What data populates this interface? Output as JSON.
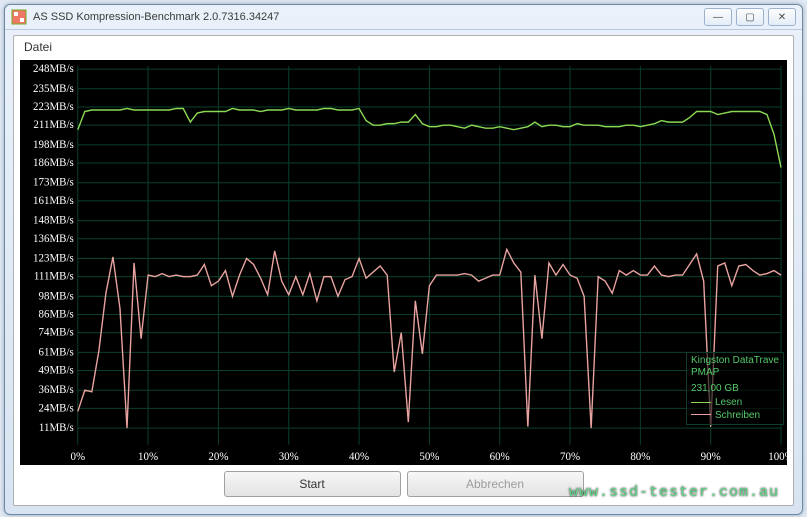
{
  "window": {
    "title": "AS SSD Kompression-Benchmark 2.0.7316.34247",
    "menu_file": "Datei",
    "btn_minimize": "—",
    "btn_maximize": "▢",
    "btn_close": "✕"
  },
  "buttons": {
    "start": "Start",
    "cancel": "Abbrechen"
  },
  "legend": {
    "device_line1": "Kingston DataTrave",
    "device_line2": "PMAP",
    "capacity": "231,00 GB",
    "read": "Lesen",
    "write": "Schreiben",
    "read_color": "#8cd953",
    "write_color": "#e9a3a0"
  },
  "watermark": "www.ssd-tester.com.au",
  "chart_data": {
    "type": "line",
    "title": "",
    "xlabel": "",
    "ylabel": "",
    "x_tick_labels": [
      "0%",
      "10%",
      "20%",
      "30%",
      "40%",
      "50%",
      "60%",
      "70%",
      "80%",
      "90%",
      "100%"
    ],
    "y_tick_labels": [
      "11MB/s",
      "24MB/s",
      "36MB/s",
      "49MB/s",
      "61MB/s",
      "74MB/s",
      "86MB/s",
      "98MB/s",
      "111MB/s",
      "123MB/s",
      "136MB/s",
      "148MB/s",
      "161MB/s",
      "173MB/s",
      "186MB/s",
      "198MB/s",
      "211MB/s",
      "223MB/s",
      "235MB/s",
      "248MB/s"
    ],
    "ylim": [
      0,
      250
    ],
    "xlim": [
      0,
      100
    ],
    "x": [
      0,
      1,
      2,
      3,
      4,
      5,
      6,
      7,
      8,
      9,
      10,
      11,
      12,
      13,
      14,
      15,
      16,
      17,
      18,
      19,
      20,
      21,
      22,
      23,
      24,
      25,
      26,
      27,
      28,
      29,
      30,
      31,
      32,
      33,
      34,
      35,
      36,
      37,
      38,
      39,
      40,
      41,
      42,
      43,
      44,
      45,
      46,
      47,
      48,
      49,
      50,
      51,
      52,
      53,
      54,
      55,
      56,
      57,
      58,
      59,
      60,
      61,
      62,
      63,
      64,
      65,
      66,
      67,
      68,
      69,
      70,
      71,
      72,
      73,
      74,
      75,
      76,
      77,
      78,
      79,
      80,
      81,
      82,
      83,
      84,
      85,
      86,
      87,
      88,
      89,
      90,
      91,
      92,
      93,
      94,
      95,
      96,
      97,
      98,
      99,
      100
    ],
    "series": [
      {
        "name": "Lesen",
        "color": "#8cd953",
        "values": [
          208,
          220,
          221,
          221,
          221,
          221,
          221,
          222,
          221,
          221,
          221,
          221,
          221,
          221,
          222,
          222,
          213,
          219,
          220,
          220,
          220,
          220,
          222,
          221,
          221,
          221,
          220,
          221,
          221,
          221,
          222,
          221,
          221,
          221,
          221,
          222,
          222,
          221,
          221,
          221,
          222,
          214,
          211,
          211,
          212,
          212,
          213,
          213,
          218,
          212,
          210,
          210,
          211,
          211,
          210,
          209,
          211,
          210,
          209,
          209,
          210,
          209,
          208,
          209,
          210,
          213,
          210,
          211,
          211,
          210,
          210,
          212,
          211,
          211,
          211,
          210,
          210,
          210,
          211,
          211,
          210,
          211,
          212,
          214,
          213,
          213,
          213,
          216,
          220,
          220,
          220,
          218,
          219,
          220,
          220,
          220,
          220,
          220,
          218,
          205,
          183
        ]
      },
      {
        "name": "Schreiben",
        "color": "#e9a3a0",
        "values": [
          22,
          36,
          35,
          62,
          100,
          124,
          90,
          11,
          120,
          70,
          112,
          111,
          113,
          111,
          112,
          111,
          111,
          112,
          119,
          105,
          108,
          115,
          98,
          112,
          123,
          119,
          110,
          99,
          128,
          108,
          99,
          111,
          99,
          113,
          95,
          111,
          111,
          98,
          109,
          111,
          123,
          110,
          114,
          118,
          112,
          48,
          74,
          15,
          95,
          60,
          105,
          112,
          112,
          112,
          112,
          113,
          112,
          108,
          110,
          112,
          112,
          129,
          120,
          114,
          12,
          112,
          70,
          120,
          112,
          119,
          112,
          110,
          98,
          11,
          111,
          108,
          100,
          115,
          112,
          115,
          112,
          112,
          118,
          112,
          111,
          112,
          112,
          119,
          126,
          108,
          12,
          118,
          120,
          105,
          118,
          119,
          115,
          112,
          113,
          115,
          112
        ]
      }
    ]
  }
}
